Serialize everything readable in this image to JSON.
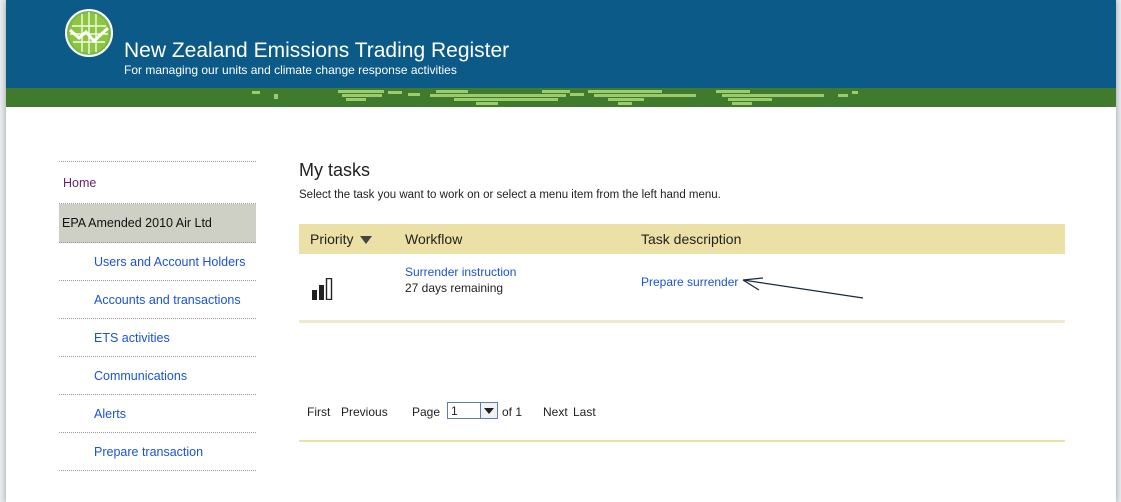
{
  "header": {
    "title": "New Zealand Emissions Trading Register",
    "subtitle": "For managing our units and climate change response activities"
  },
  "sidebar": {
    "home": "Home",
    "account": "EPA Amended 2010 Air Ltd",
    "items": [
      {
        "label": "Users and Account Holders"
      },
      {
        "label": "Accounts and transactions"
      },
      {
        "label": "ETS activities"
      },
      {
        "label": "Communications"
      },
      {
        "label": "Alerts"
      },
      {
        "label": "Prepare transaction"
      }
    ]
  },
  "main": {
    "heading": "My tasks",
    "instructions": "Select the task you want to work on or select a menu item from the left hand menu.",
    "table": {
      "columns": [
        "Priority",
        "Workflow",
        "Task description"
      ],
      "rows": [
        {
          "priority_icon": "signal-bars-icon",
          "workflow": "Surrender instruction",
          "remaining": "27 days remaining",
          "task": "Prepare surrender"
        }
      ]
    },
    "pager": {
      "first": "First",
      "previous": "Previous",
      "page_label": "Page",
      "page_value": "1",
      "of_label": "of 1",
      "next": "Next",
      "last": "Last"
    }
  },
  "colors": {
    "header_blue": "#0c5a88",
    "map_green": "#3f7a2d",
    "table_header": "#ebe1a6",
    "link_blue": "#1a52d8",
    "home_purple": "#6a1f6c",
    "account_grey": "#cfd0c5"
  }
}
